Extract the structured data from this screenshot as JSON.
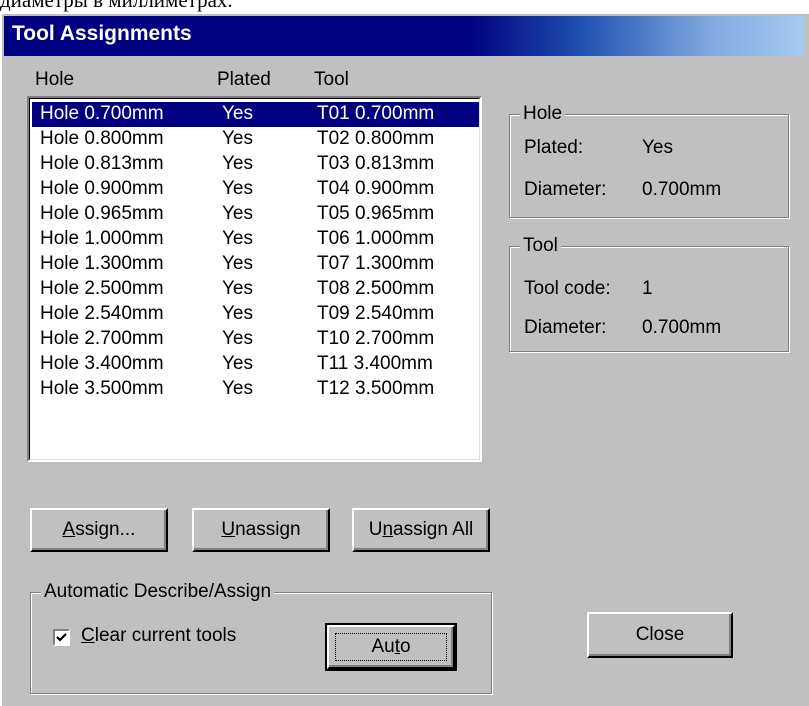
{
  "caption_text": "диаметры в миллиметрах.",
  "window": {
    "title": "Tool Assignments"
  },
  "list": {
    "headers": {
      "hole": "Hole",
      "plated": "Plated",
      "tool": "Tool"
    },
    "rows": [
      {
        "hole": "Hole 0.700mm",
        "plated": "Yes",
        "tool": "T01 0.700mm",
        "selected": true
      },
      {
        "hole": "Hole 0.800mm",
        "plated": "Yes",
        "tool": "T02 0.800mm"
      },
      {
        "hole": "Hole 0.813mm",
        "plated": "Yes",
        "tool": "T03 0.813mm"
      },
      {
        "hole": "Hole 0.900mm",
        "plated": "Yes",
        "tool": "T04 0.900mm"
      },
      {
        "hole": "Hole 0.965mm",
        "plated": "Yes",
        "tool": "T05 0.965mm"
      },
      {
        "hole": "Hole 1.000mm",
        "plated": "Yes",
        "tool": "T06 1.000mm"
      },
      {
        "hole": "Hole 1.300mm",
        "plated": "Yes",
        "tool": "T07 1.300mm"
      },
      {
        "hole": "Hole 2.500mm",
        "plated": "Yes",
        "tool": "T08 2.500mm"
      },
      {
        "hole": "Hole 2.540mm",
        "plated": "Yes",
        "tool": "T09 2.540mm"
      },
      {
        "hole": "Hole 2.700mm",
        "plated": "Yes",
        "tool": "T10 2.700mm"
      },
      {
        "hole": "Hole 3.400mm",
        "plated": "Yes",
        "tool": "T11 3.400mm"
      },
      {
        "hole": "Hole 3.500mm",
        "plated": "Yes",
        "tool": "T12 3.500mm"
      }
    ]
  },
  "hole_group": {
    "title": "Hole",
    "plated_label": "Plated:",
    "plated_value": "Yes",
    "diameter_label": "Diameter:",
    "diameter_value": "0.700mm"
  },
  "tool_group": {
    "title": "Tool",
    "code_label": "Tool code:",
    "code_value": "1",
    "diameter_label": "Diameter:",
    "diameter_value": "0.700mm"
  },
  "buttons": {
    "assign": {
      "pre": "",
      "key": "A",
      "post": "ssign..."
    },
    "unassign": {
      "pre": "",
      "key": "U",
      "post": "nassign"
    },
    "unassign_all": {
      "pre": "U",
      "key": "n",
      "post": "assign All"
    },
    "auto": {
      "pre": "Au",
      "key": "t",
      "post": "o"
    },
    "close": "Close"
  },
  "auto_group": {
    "title": "Automatic Describe/Assign",
    "checkbox": {
      "pre": "",
      "key": "C",
      "post": "lear current tools",
      "checked": true
    }
  }
}
